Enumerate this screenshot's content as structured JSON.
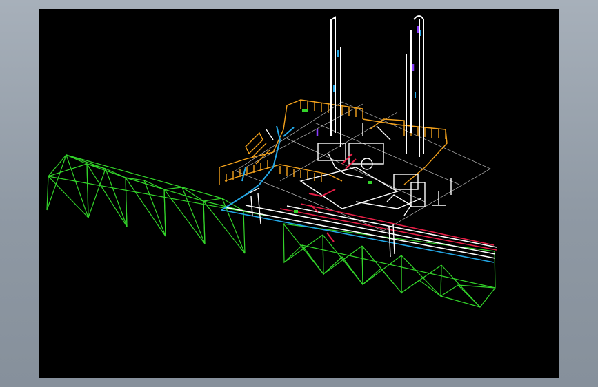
{
  "window": {
    "title": ""
  },
  "colors": {
    "background": "#000000",
    "pipe_rack": "#33d42a",
    "platform_railing": "#f4a21c",
    "pipes_main": "#ffffff",
    "pipes_process": "#e61e46",
    "pipes_water": "#23a7e6",
    "equipment": "#ffffff",
    "accents": "#8a3cff",
    "grid": "#b8b8b8"
  },
  "icons": {
    "model": "3d-piping-plant-icon"
  }
}
